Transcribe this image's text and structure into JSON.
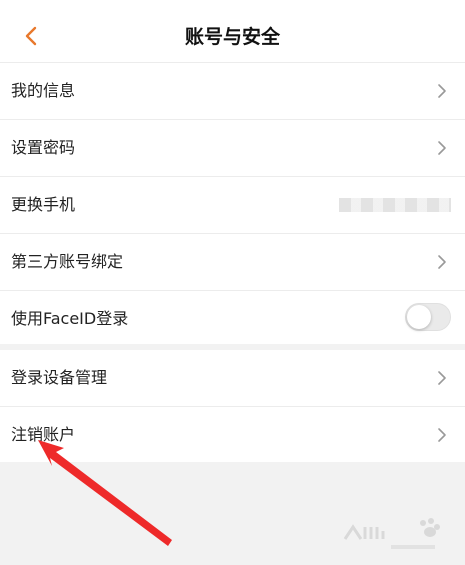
{
  "header": {
    "title": "账号与安全",
    "back_icon": "chevron-left-icon",
    "accent_color": "#e8782c"
  },
  "group1": {
    "items": [
      {
        "label": "我的信息",
        "trailing": "chevron-right-icon"
      },
      {
        "label": "设置密码",
        "trailing": "chevron-right-icon"
      },
      {
        "label": "更换手机",
        "trailing": "masked-phone-number"
      },
      {
        "label": "第三方账号绑定",
        "trailing": "chevron-right-icon"
      },
      {
        "label": "使用FaceID登录",
        "trailing": "toggle-switch",
        "toggle_on": false
      }
    ]
  },
  "group2": {
    "items": [
      {
        "label": "登录设备管理",
        "trailing": "chevron-right-icon"
      },
      {
        "label": "注销账户",
        "trailing": "chevron-right-icon"
      }
    ]
  },
  "annotation": {
    "arrow_color": "#ee2a2a",
    "target": "注销账户"
  }
}
